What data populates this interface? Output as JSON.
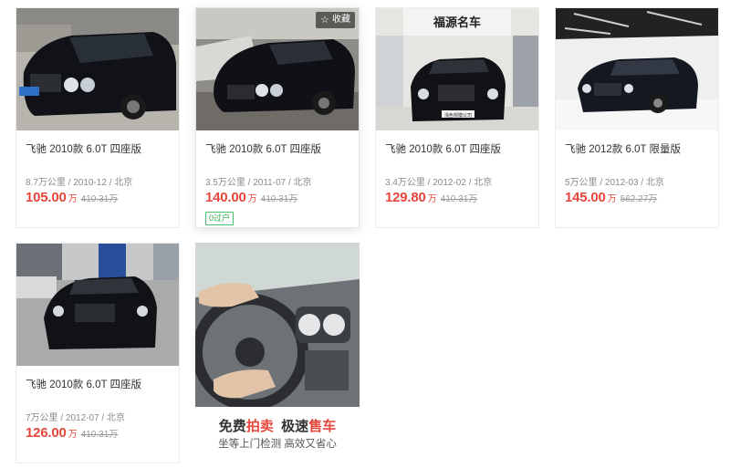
{
  "listings": [
    {
      "title": "飞驰 2010款 6.0T 四座版",
      "meta": "8.7万公里 / 2010-12 / 北京",
      "price": "105.00",
      "unit": "万",
      "original_price": "410.31万"
    },
    {
      "title": "飞驰 2010款 6.0T 四座版",
      "meta": "3.5万公里 / 2011-07 / 北京",
      "price": "140.00",
      "unit": "万",
      "original_price": "410.31万",
      "favorite_label": "收藏",
      "tag": "0过户"
    },
    {
      "title": "飞驰 2010款 6.0T 四座版",
      "meta": "3.4万公里 / 2012-02 / 北京",
      "price": "129.80",
      "unit": "万",
      "original_price": "410.31万"
    },
    {
      "title": "飞驰 2012款 6.0T 限量版",
      "meta": "5万公里 / 2012-03 / 北京",
      "price": "145.00",
      "unit": "万",
      "original_price": "562.27万"
    },
    {
      "title": "飞驰 2010款 6.0T 四座版",
      "meta": "7万公里 / 2012-07 / 北京",
      "price": "126.00",
      "unit": "万",
      "original_price": "410.31万"
    }
  ],
  "ad": {
    "line1_a": "免费",
    "line1_b": "拍卖",
    "line1_c": "极速",
    "line1_d": "售车",
    "line2": "坐等上门检测  高效又省心"
  },
  "photo_text": {
    "dealer_sign": "福源名车",
    "plate": "京A",
    "plate_3": "浅色规模公司"
  },
  "colors": {
    "price": "#e8463b",
    "tag": "#2eae4f"
  }
}
